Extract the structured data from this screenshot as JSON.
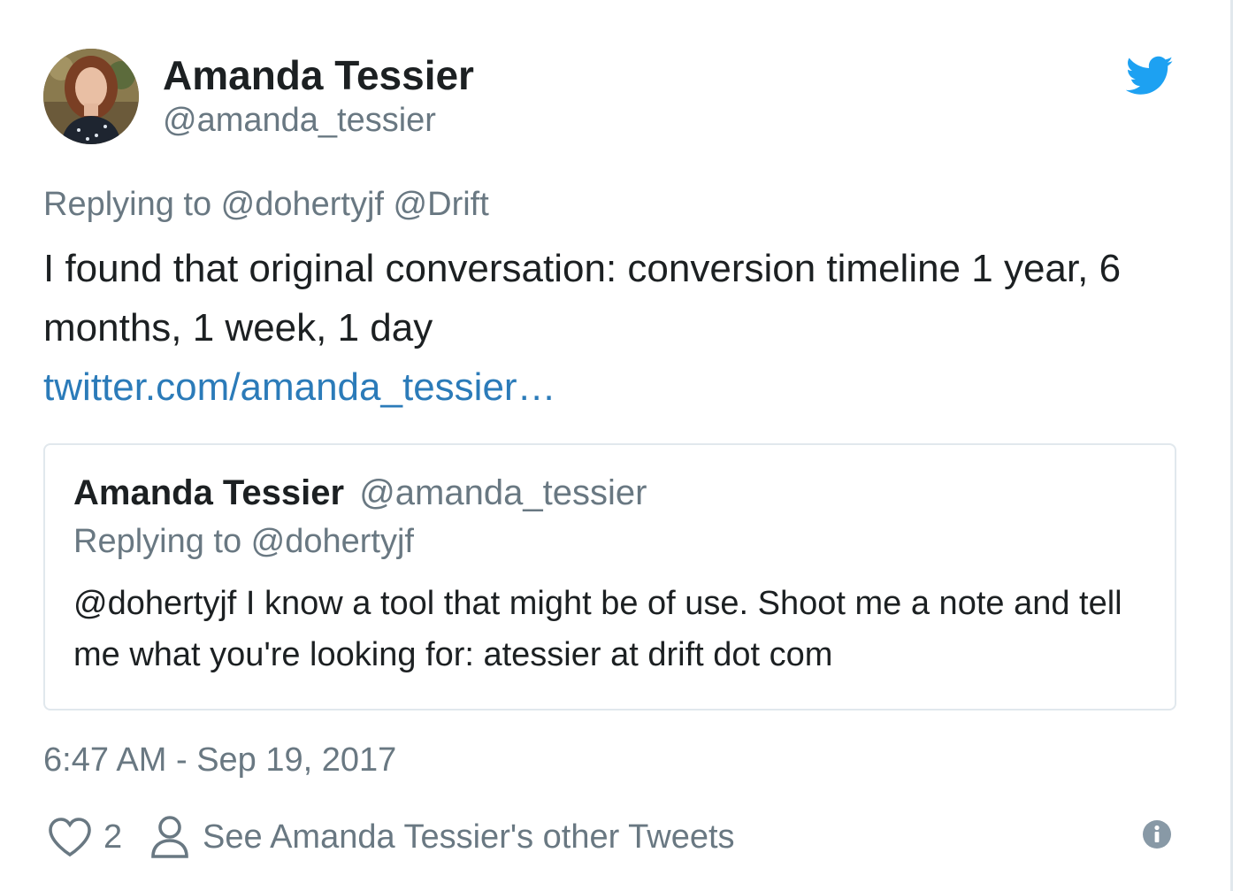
{
  "author": {
    "name": "Amanda Tessier",
    "handle": "@amanda_tessier"
  },
  "tweet": {
    "replying_to": "Replying to @dohertyjf @Drift",
    "text": "I found that original conversation: conversion timeline 1 year, 6 months, 1 week, 1 day",
    "link": "twitter.com/amanda_tessier…",
    "timestamp": "6:47 AM - Sep 19, 2017",
    "like_count": "2",
    "see_other_label": "See Amanda Tessier's other Tweets"
  },
  "quoted_tweet": {
    "name": "Amanda Tessier",
    "handle": "@amanda_tessier",
    "replying_to": "Replying to @dohertyjf",
    "text": "@dohertyjf I know a tool that might be of use. Shoot me a note and tell me what you're looking for: atessier at drift dot com"
  },
  "icons": {
    "brand": "twitter-bird-icon",
    "like": "heart-icon",
    "profile": "person-icon",
    "info": "info-icon"
  },
  "colors": {
    "brand_blue": "#1da1f2",
    "link_blue": "#2b7bb9",
    "secondary_text": "#697882",
    "primary_text": "#1c2022",
    "border": "#e1e8ed"
  }
}
